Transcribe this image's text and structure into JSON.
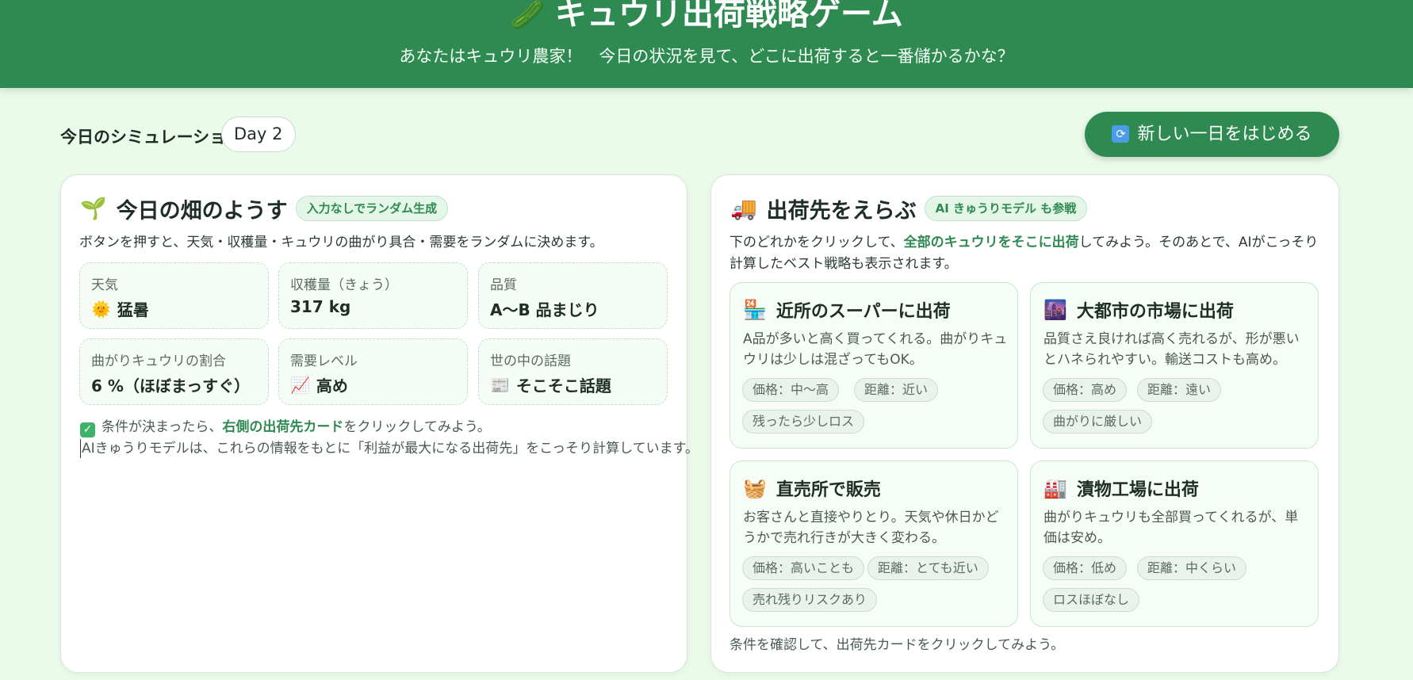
{
  "header": {
    "icon": "cucumber-icon",
    "title": "キュウリ出荷戦略ゲーム",
    "subtitle": "あなたはキュウリ農家！　今日の状況を見て、どこに出荷すると一番儲かるかな？"
  },
  "toolbar": {
    "sim_label": "今日のシミュレーション",
    "day": "Day 2",
    "new_day_button": "新しい一日をはじめる"
  },
  "field_panel": {
    "icon": "seedling-icon",
    "title": "今日の畑のようす",
    "tag": "入力なしでランダム生成",
    "description": "ボタンを押すと、天気・収穫量・キュウリの曲がり具合・需要をランダムに決めます。",
    "stats": [
      {
        "label": "天気",
        "icon": "sun-icon",
        "value": "猛暑"
      },
      {
        "label": "収穫量（きょう）",
        "value": "317 kg"
      },
      {
        "label": "品質",
        "value": "A〜B 品まじり"
      },
      {
        "label": "曲がりキュウリの割合",
        "value": "6 %（ほぼまっすぐ）"
      },
      {
        "label": "需要レベル",
        "icon": "chart-up-icon",
        "value": "高め"
      },
      {
        "label": "世の中の話題",
        "icon": "newspaper-icon",
        "value": "そこそこ話題"
      }
    ],
    "hint_prefix": "条件が決まったら、",
    "hint_emphasis": "右側の出荷先カード",
    "hint_suffix": "をクリックしてみよう。",
    "ai_note": "AIきゅうりモデルは、これらの情報をもとに「利益が最大になる出荷先」をこっそり計算しています。"
  },
  "dest_panel": {
    "icon": "truck-icon",
    "title": "出荷先をえらぶ",
    "tag": "AI きゅうりモデル も参戦",
    "desc_prefix": "下のどれかをクリックして、",
    "desc_emphasis": "全部のキュウリをそこに出荷",
    "desc_suffix": "してみよう。そのあとで、AIがこっそり計算したベスト戦略も表示されます。",
    "destinations": [
      {
        "icon": "convenience-store-icon",
        "title": "近所のスーパーに出荷",
        "description": "A品が多いと高く買ってくれる。曲がりキュウリは少しは混ざってもOK。",
        "chips": [
          "価格：中〜高",
          "距離：近い",
          "残ったら少しロス"
        ]
      },
      {
        "icon": "city-icon",
        "title": "大都市の市場に出荷",
        "description": "品質さえ良ければ高く売れるが、形が悪いとハネられやすい。輸送コストも高め。",
        "chips": [
          "価格：高め",
          "距離：遠い",
          "曲がりに厳しい"
        ]
      },
      {
        "icon": "basket-icon",
        "title": "直売所で販売",
        "description": "お客さんと直接やりとり。天気や休日かどうかで売れ行きが大きく変わる。",
        "chips": [
          "価格：高いことも",
          "距離：とても近い",
          "売れ残りリスクあり"
        ]
      },
      {
        "icon": "factory-icon",
        "title": "漬物工場に出荷",
        "description": "曲がりキュウリも全部買ってくれるが、単価は安め。",
        "chips": [
          "価格：低め",
          "距離：中くらい",
          "ロスほぼなし"
        ]
      }
    ],
    "footer_note": "条件を確認して、出荷先カードをクリックしてみよう。"
  }
}
